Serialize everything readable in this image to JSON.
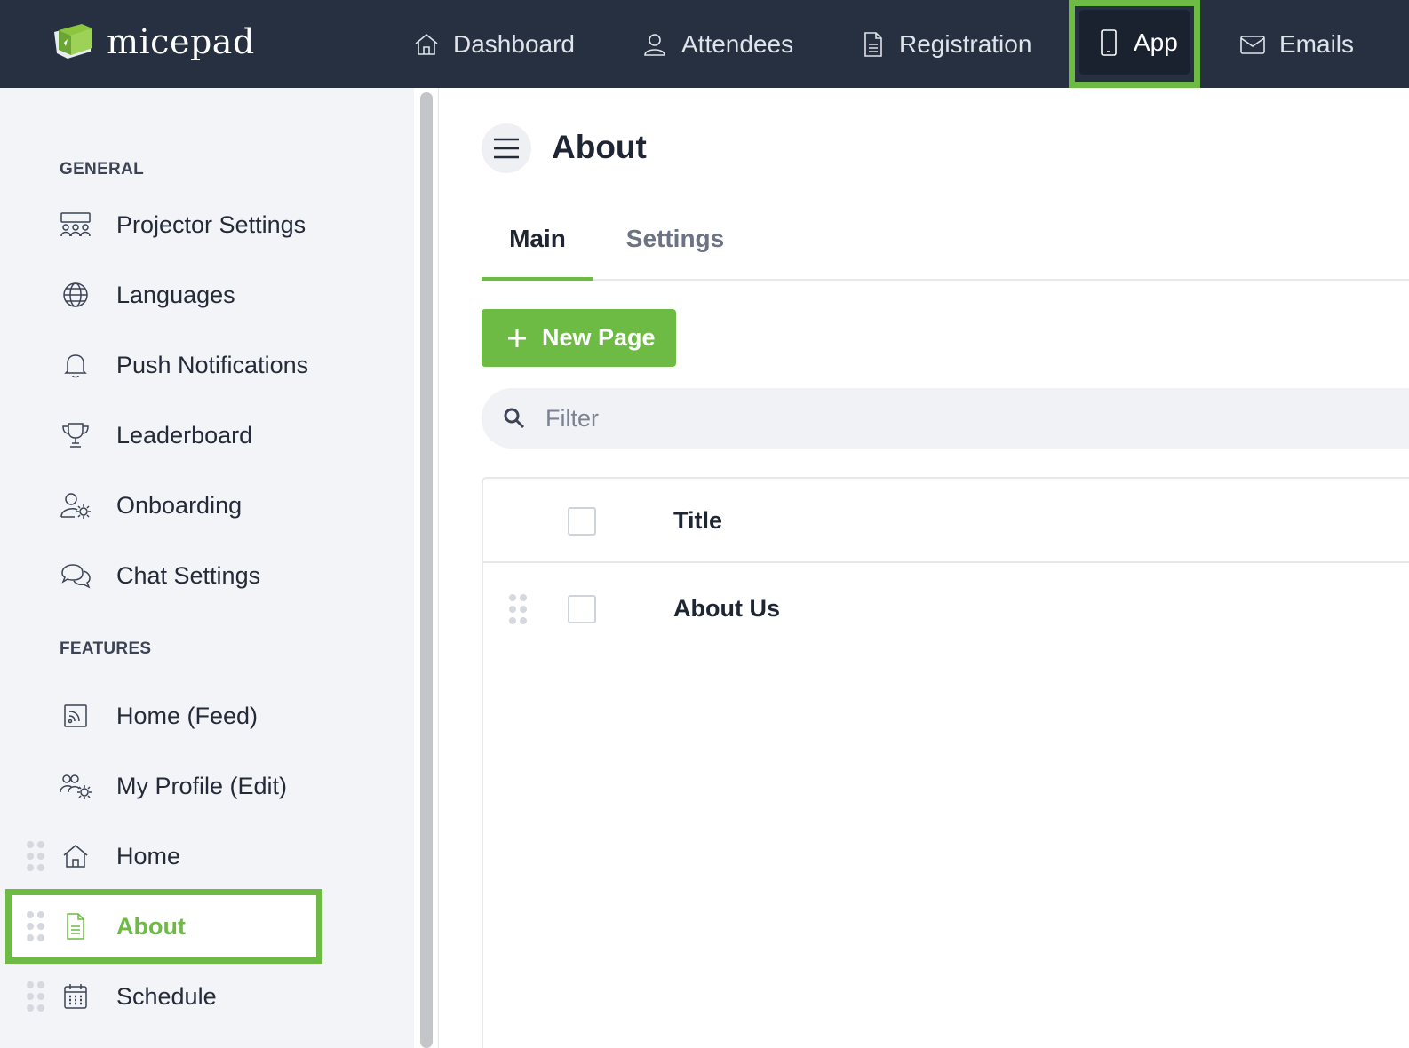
{
  "brand": {
    "name": "micepad"
  },
  "topnav": {
    "items": [
      {
        "key": "dashboard",
        "label": "Dashboard",
        "icon": "home-icon"
      },
      {
        "key": "attendees",
        "label": "Attendees",
        "icon": "user-icon"
      },
      {
        "key": "registration",
        "label": "Registration",
        "icon": "document-icon"
      },
      {
        "key": "app",
        "label": "App",
        "icon": "mobile-icon",
        "active": true
      },
      {
        "key": "emails",
        "label": "Emails",
        "icon": "envelope-icon"
      }
    ]
  },
  "sidebar": {
    "general_label": "GENERAL",
    "features_label": "FEATURES",
    "general": [
      {
        "label": "Projector Settings",
        "icon": "audience-icon"
      },
      {
        "label": "Languages",
        "icon": "globe-icon"
      },
      {
        "label": "Push Notifications",
        "icon": "bell-icon"
      },
      {
        "label": "Leaderboard",
        "icon": "trophy-icon"
      },
      {
        "label": "Onboarding",
        "icon": "user-gear-icon"
      },
      {
        "label": "Chat Settings",
        "icon": "chat-bubbles-icon"
      }
    ],
    "features": [
      {
        "label": "Home (Feed)",
        "icon": "feed-icon"
      },
      {
        "label": "My Profile (Edit)",
        "icon": "users-gear-icon"
      },
      {
        "label": "Home",
        "icon": "home-icon",
        "draggable": true
      },
      {
        "label": "About",
        "icon": "document-icon",
        "draggable": true,
        "active": true
      },
      {
        "label": "Schedule",
        "icon": "calendar-icon",
        "draggable": true
      }
    ]
  },
  "main": {
    "title": "About",
    "tabs": [
      {
        "label": "Main",
        "active": true
      },
      {
        "label": "Settings",
        "active": false
      }
    ],
    "new_page_label": "New Page",
    "filter_placeholder": "Filter",
    "table": {
      "header_title": "Title",
      "rows": [
        {
          "title": "About Us"
        }
      ]
    }
  },
  "colors": {
    "accent": "#6dbb45",
    "topbar": "#263040",
    "sidebar_bg": "#f3f4f7"
  }
}
